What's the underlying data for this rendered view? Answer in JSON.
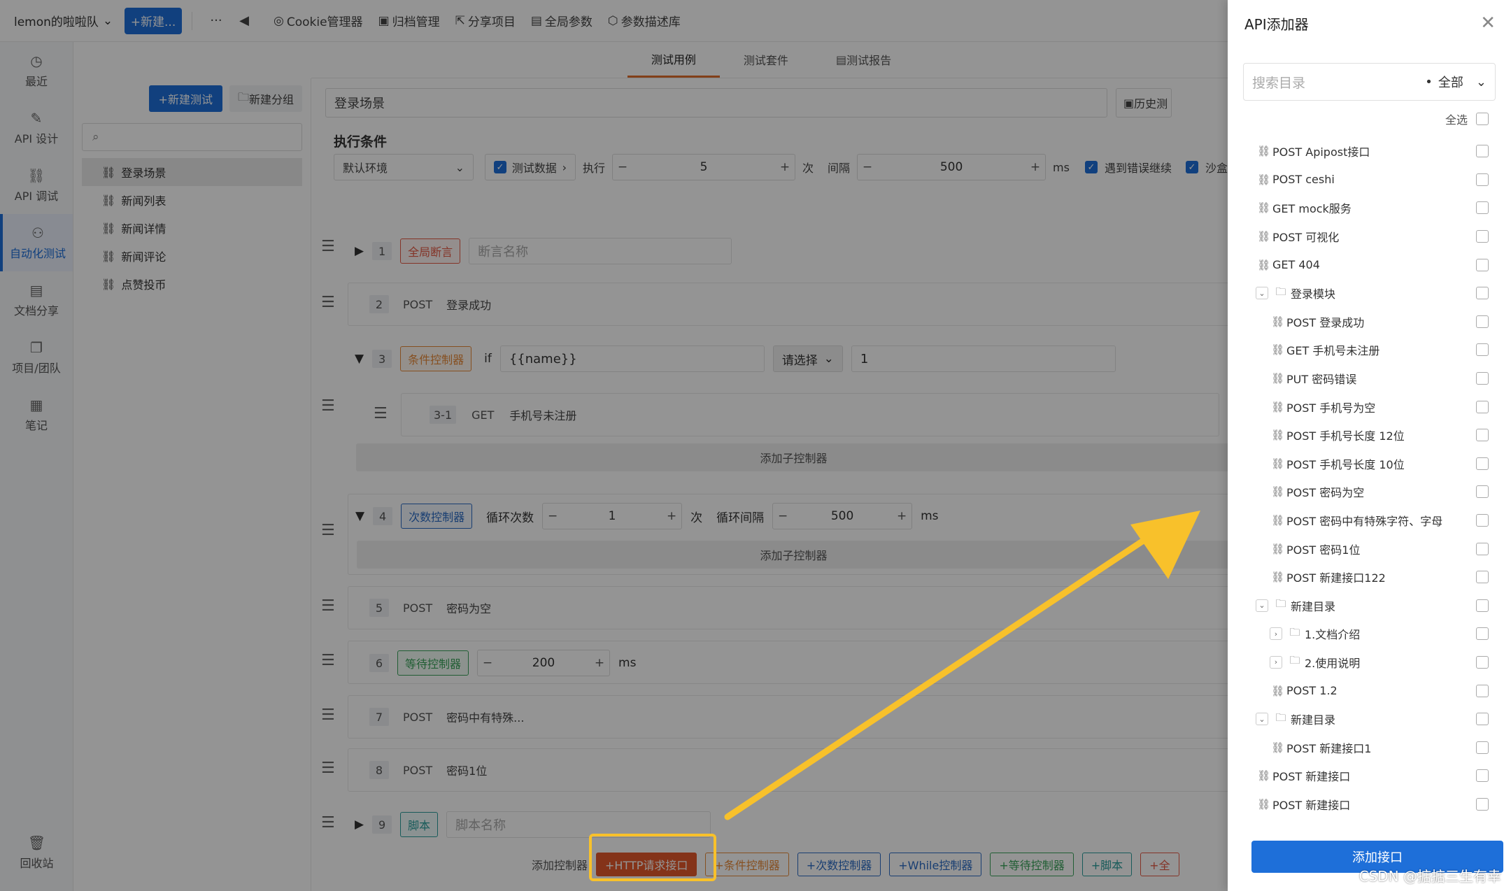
{
  "topbar": {
    "team": "lemon的啦啦队",
    "new_button": "+新建...",
    "more": "···",
    "items": [
      "Cookie管理器",
      "归档管理",
      "分享项目",
      "全局参数",
      "参数描述库"
    ]
  },
  "leftnav": {
    "items": [
      "最近",
      "API 设计",
      "API 调试",
      "自动化测试",
      "文档分享",
      "项目/团队",
      "笔记"
    ],
    "bottom": "回收站"
  },
  "tree": {
    "new_test": "+新建测试",
    "new_group": "新建分组",
    "items": [
      "登录场景",
      "新闻列表",
      "新闻详情",
      "新闻评论",
      "点赞投币"
    ]
  },
  "tabs": [
    "测试用例",
    "测试套件",
    "测试报告"
  ],
  "scenario": {
    "name": "登录场景",
    "history": "历史测"
  },
  "exec": {
    "title": "执行条件",
    "env": "默认环境",
    "test_data": "测试数据",
    "execute": "执行",
    "times_value": "5",
    "times_unit": "次",
    "interval": "间隔",
    "interval_value": "500",
    "interval_unit": "ms",
    "continue_on_error": "遇到错误继续",
    "sandbox": "沙盒"
  },
  "steps": {
    "s1": {
      "num": "1",
      "tag": "全局断言",
      "placeholder": "断言名称"
    },
    "s2": {
      "num": "2",
      "method": "POST",
      "name": "登录成功"
    },
    "s3": {
      "num": "3",
      "tag": "条件控制器",
      "if": "if",
      "expr": "{{name}}",
      "op": "请选择",
      "value": "1",
      "child": {
        "num": "3-1",
        "method": "GET",
        "name": "手机号未注册"
      },
      "add_sub": "添加子控制器"
    },
    "s4": {
      "num": "4",
      "tag": "次数控制器",
      "loops_label": "循环次数",
      "loops": "1",
      "times_unit": "次",
      "interval_label": "循环间隔",
      "interval": "500",
      "interval_unit": "ms",
      "add_sub": "添加子控制器"
    },
    "s5": {
      "num": "5",
      "method": "POST",
      "name": "密码为空"
    },
    "s6": {
      "num": "6",
      "tag": "等待控制器",
      "value": "200",
      "unit": "ms"
    },
    "s7": {
      "num": "7",
      "method": "POST",
      "name": "密码中有特殊..."
    },
    "s8": {
      "num": "8",
      "method": "POST",
      "name": "密码1位"
    },
    "s9": {
      "num": "9",
      "tag": "脚本",
      "placeholder": "脚本名称"
    }
  },
  "bottom": {
    "label": "添加控制器",
    "http": "+HTTP请求接口",
    "cond": "+条件控制器",
    "count": "+次数控制器",
    "while": "+While控制器",
    "wait": "+等待控制器",
    "script": "+脚本",
    "all": "+全"
  },
  "drawer": {
    "title": "API添加器",
    "search_placeholder": "搜索目录",
    "scope": "全部",
    "select_all": "全选",
    "add_button": "添加接口",
    "items": [
      {
        "level": 0,
        "type": "api",
        "text": "POST Apipost接口"
      },
      {
        "level": 0,
        "type": "api",
        "text": "POST ceshi"
      },
      {
        "level": 0,
        "type": "api",
        "text": "GET mock服务"
      },
      {
        "level": 0,
        "type": "api",
        "text": "POST 可视化"
      },
      {
        "level": 0,
        "type": "api",
        "text": "GET 404"
      },
      {
        "level": 0,
        "type": "folder-open",
        "text": "登录模块"
      },
      {
        "level": 1,
        "type": "api",
        "text": "POST 登录成功"
      },
      {
        "level": 1,
        "type": "api",
        "text": "GET 手机号未注册"
      },
      {
        "level": 1,
        "type": "api",
        "text": "PUT 密码错误"
      },
      {
        "level": 1,
        "type": "api",
        "text": "POST 手机号为空"
      },
      {
        "level": 1,
        "type": "api",
        "text": "POST 手机号长度 12位"
      },
      {
        "level": 1,
        "type": "api",
        "text": "POST 手机号长度 10位"
      },
      {
        "level": 1,
        "type": "api",
        "text": "POST 密码为空"
      },
      {
        "level": 1,
        "type": "api",
        "text": "POST 密码中有特殊字符、字母"
      },
      {
        "level": 1,
        "type": "api",
        "text": "POST 密码1位"
      },
      {
        "level": 1,
        "type": "api",
        "text": "POST 新建接口122"
      },
      {
        "level": 0,
        "type": "folder-open",
        "text": "新建目录"
      },
      {
        "level": 1,
        "type": "folder-closed",
        "text": "1.文档介绍"
      },
      {
        "level": 1,
        "type": "folder-closed",
        "text": "2.使用说明"
      },
      {
        "level": 1,
        "type": "api",
        "text": "POST 1.2"
      },
      {
        "level": 0,
        "type": "folder-open",
        "text": "新建目录"
      },
      {
        "level": 1,
        "type": "api",
        "text": "POST 新建接口1"
      },
      {
        "level": 0,
        "type": "api",
        "text": "POST 新建接口"
      },
      {
        "level": 0,
        "type": "api",
        "text": "POST 新建接口"
      }
    ]
  },
  "watermark": "CSDN @掂掂三生有幸",
  "colors": {
    "primary": "#1e6fd9",
    "http_button": "#e3582b",
    "highlight": "#f8c12b",
    "active_tab": "#e06f2c"
  }
}
